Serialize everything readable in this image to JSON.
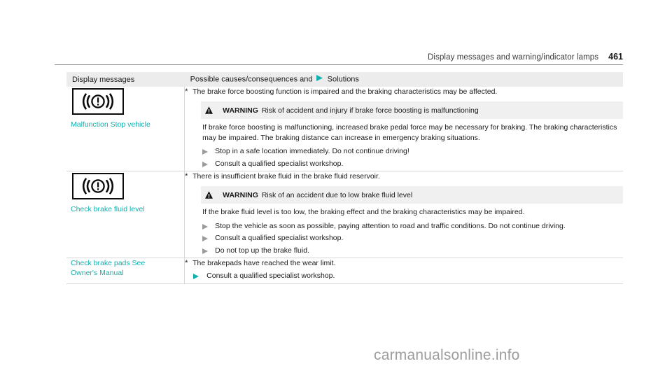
{
  "page_header": {
    "title": "Display messages and warning/indicator lamps",
    "page_number": "461"
  },
  "colors": {
    "teal": "#13b0ae",
    "header_band": "#ececec",
    "warning_band": "#f0f0f0",
    "bullet_gray": "#9b9b9b",
    "watermark_gray": "#9c9c9c"
  },
  "table": {
    "columns": {
      "left_header": "Display messages",
      "right_header_before": "Possible causes/consequences and",
      "right_header_icon": "solutions-triangle-icon",
      "right_header_after": "Solutions"
    },
    "rows": [
      {
        "lamp_icon": "brake-warning-lamp-icon",
        "message": "Malfunction Stop vehicle",
        "cause_marker": "*",
        "cause": "The brake force boosting function is impaired and the braking characteristics may be affected.",
        "warning": {
          "icon": "warning-triangle-icon",
          "title": "WARNING",
          "heading": "Risk of accident and injury if brake force boosting is malfunctioning",
          "body": "If brake force boosting is malfunctioning, increased brake pedal force may be necessary for braking. The braking characteristics may be impaired. The braking distance can increase in emergency braking situations.",
          "solutions": [
            "Stop in a safe location immediately. Do not continue driving!",
            "Consult a qualified specialist workshop."
          ]
        }
      },
      {
        "lamp_icon": "brake-warning-lamp-icon",
        "message": "Check brake fluid level",
        "cause_marker": "*",
        "cause": "There is insufficient brake fluid in the brake fluid reservoir.",
        "warning": {
          "icon": "warning-triangle-icon",
          "title": "WARNING",
          "heading": "Risk of an accident due to low brake fluid level",
          "body": "If the brake fluid level is too low, the braking effect and the braking characteristics may be impaired.",
          "solutions": [
            "Stop the vehicle as soon as possible, paying attention to road and traffic conditions. Do not continue driving.",
            "Consult a qualified specialist workshop.",
            "Do not top up the brake fluid."
          ]
        }
      },
      {
        "message_line1": "Check brake pads See",
        "message_line2": "Owner's Manual",
        "cause_marker": "*",
        "cause": "The brakepads have reached the wear limit.",
        "solution": "Consult a qualified specialist workshop."
      }
    ]
  },
  "watermark": "carmanualsonline.info"
}
